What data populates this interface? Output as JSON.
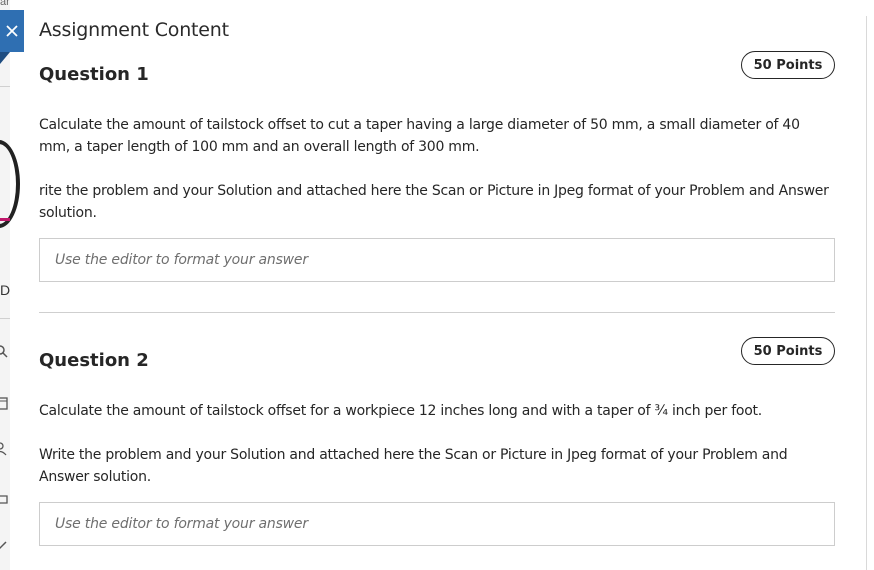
{
  "background": {
    "top_text": "ar",
    "side_letter": "D"
  },
  "panel": {
    "title": "Assignment Content"
  },
  "questions": [
    {
      "title": "Question 1",
      "points": "50 Points",
      "paragraphs": [
        "Calculate the amount of tailstock offset to cut a taper having a large diameter of 50 mm, a small diameter of 40 mm, a taper length of 100 mm and an overall length of 300 mm.",
        "rite the problem and your Solution and attached here the Scan or Picture in Jpeg format of your Problem and Answer solution."
      ],
      "editor_placeholder": "Use the editor to format your answer"
    },
    {
      "title": "Question 2",
      "points": "50 Points",
      "paragraphs": [
        "Calculate the amount of tailstock offset for a workpiece 12 inches long and with a taper of ¾ inch per foot.",
        "Write the problem and your Solution and attached here the Scan or Picture in Jpeg format of your Problem and Answer solution."
      ],
      "editor_placeholder": "Use the editor to format your answer"
    }
  ],
  "colors": {
    "close_button": "#2f6fb2",
    "accent_magenta": "#c0186c"
  }
}
